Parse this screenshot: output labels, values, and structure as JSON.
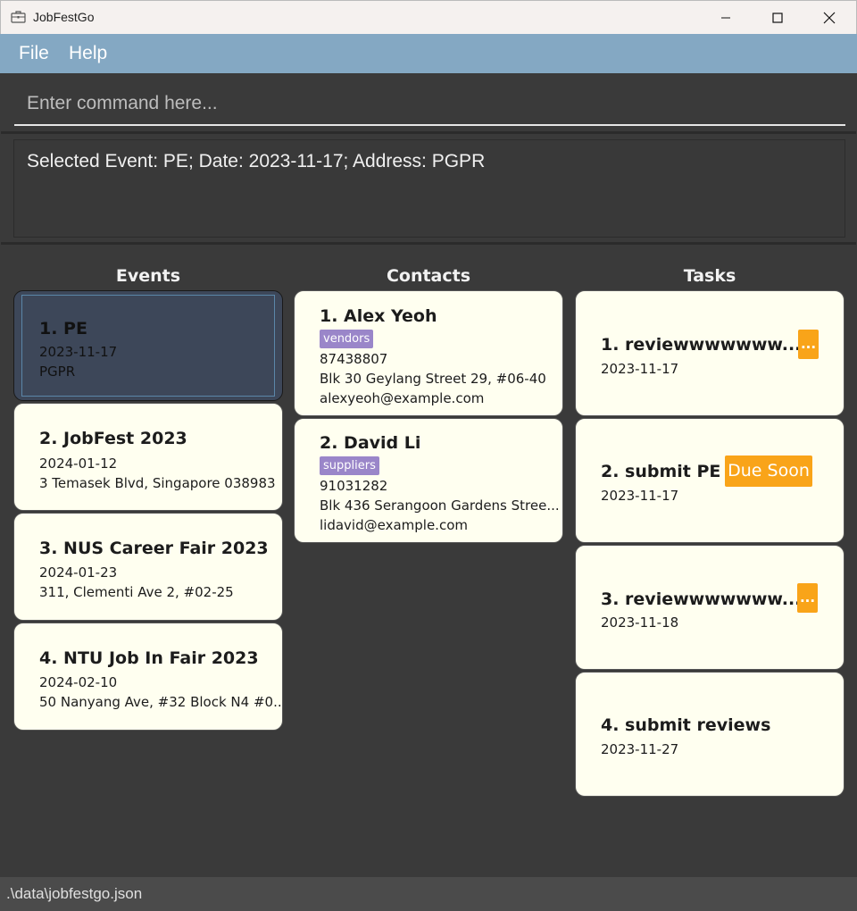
{
  "window": {
    "title": "JobFestGo"
  },
  "menu": {
    "file": "File",
    "help": "Help"
  },
  "command": {
    "placeholder": "Enter command here..."
  },
  "result": {
    "text": "Selected Event: PE; Date: 2023-11-17; Address: PGPR"
  },
  "columns": {
    "events": "Events",
    "contacts": "Contacts",
    "tasks": "Tasks"
  },
  "events": [
    {
      "title": "1.  PE",
      "date": "2023-11-17",
      "address": "PGPR",
      "selected": true
    },
    {
      "title": "2.  JobFest 2023",
      "date": "2024-01-12",
      "address": "3 Temasek Blvd, Singapore 038983"
    },
    {
      "title": "3.  NUS Career Fair 2023",
      "date": "2024-01-23",
      "address": "311, Clementi Ave 2, #02-25"
    },
    {
      "title": "4.  NTU Job In Fair 2023",
      "date": "2024-02-10",
      "address": "50 Nanyang Ave, #32 Block N4 #0..."
    }
  ],
  "contacts": [
    {
      "name": "1.  Alex Yeoh",
      "tag": "vendors",
      "phone": "87438807",
      "address": "Blk 30 Geylang Street 29, #06-40",
      "email": "alexyeoh@example.com"
    },
    {
      "name": "2.  David Li",
      "tag": "suppliers",
      "phone": "91031282",
      "address": "Blk 436 Serangoon Gardens Stree...",
      "email": "lidavid@example.com"
    }
  ],
  "tasks": [
    {
      "title": "1.  reviewwwwwww...",
      "date": "2023-11-17",
      "badge": "..."
    },
    {
      "title": "2.  submit PE",
      "date": "2023-11-17",
      "badge": "Due Soon"
    },
    {
      "title": "3.  reviewwwwwww...",
      "date": "2023-11-18",
      "badge": "..."
    },
    {
      "title": "4.  submit reviews",
      "date": "2023-11-27"
    }
  ],
  "status": {
    "path": ".\\data\\jobfestgo.json"
  },
  "colors": {
    "menubar": "#84a8c3",
    "card": "#fffff0",
    "selected_card": "#3d4759",
    "badge": "#f9a419",
    "tag": "#9a86c9"
  }
}
